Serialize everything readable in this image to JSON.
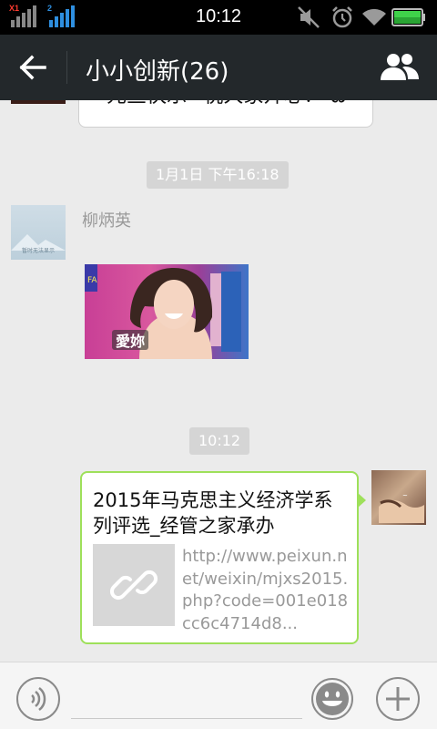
{
  "status_bar": {
    "time": "10:12",
    "sim1_tag": "X1",
    "sim2_tag": "2",
    "battery_color": "#3fd24a"
  },
  "header": {
    "title": "小小创新(26)"
  },
  "messages": {
    "previous_text": "元旦快乐~祝大家开心！ ω",
    "time_1": "1月1日 下午16:18",
    "sender_name": "柳炳英",
    "avatar_caption": "暂时无法显示",
    "sticker_caption": "愛妳",
    "time_2": "10:12",
    "link": {
      "title": "2015年马克思主义经济学系列评选_经管之家承办",
      "url": "http://www.peixun.net/weixin/mjxs2015.php?code=001e018cc6c4714d8..."
    }
  },
  "colors": {
    "header_bg": "#23282b",
    "link_border": "#9ee05a",
    "chat_bg": "#ebebeb"
  },
  "icons": [
    "back-arrow-icon",
    "group-members-icon",
    "voice-icon",
    "emoji-icon",
    "plus-icon",
    "link-icon",
    "mute-icon",
    "alarm-icon",
    "wifi-icon",
    "battery-icon",
    "signal-icon"
  ]
}
